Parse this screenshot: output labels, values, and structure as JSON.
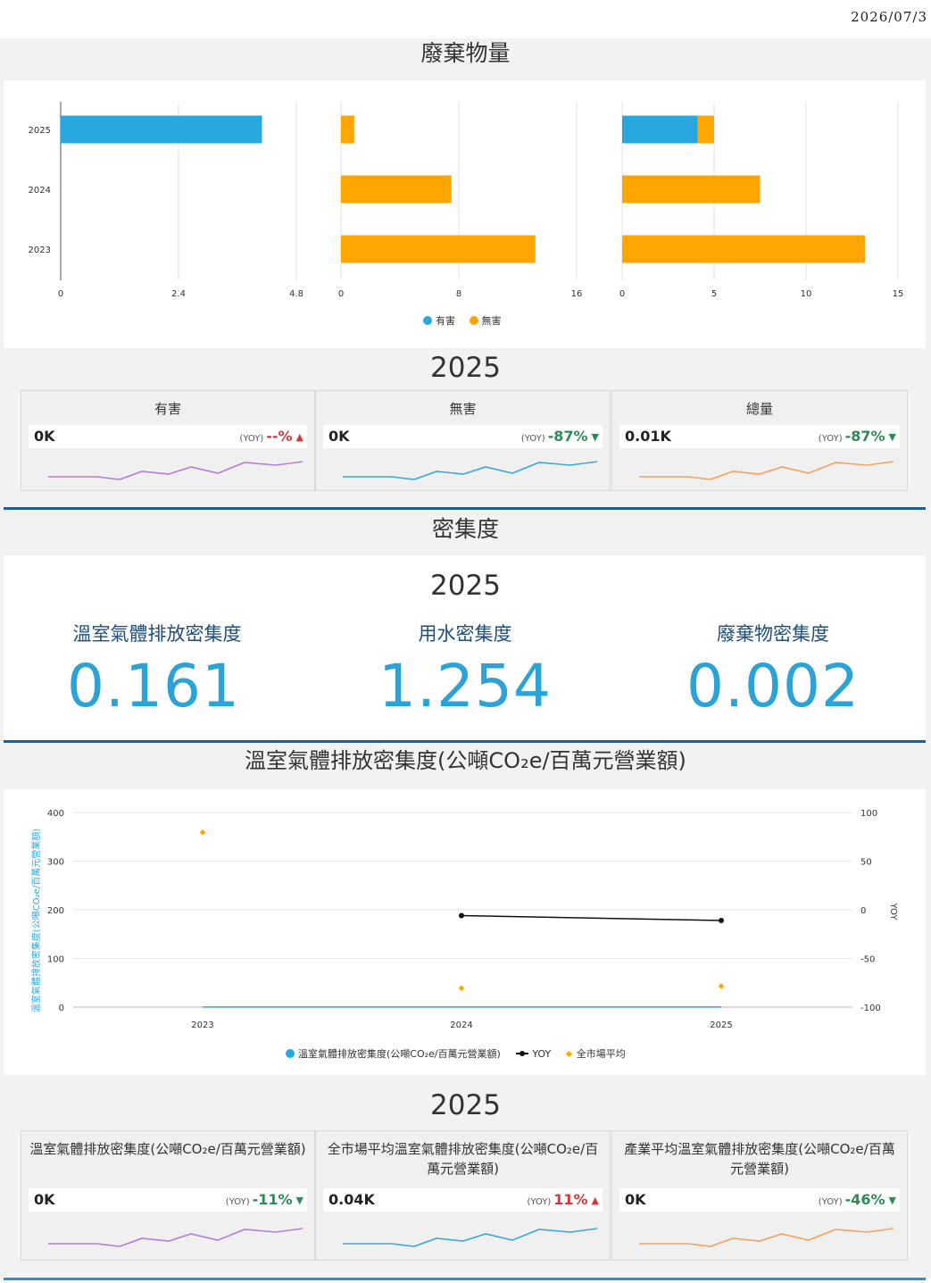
{
  "header": {
    "date": "2026/07/3"
  },
  "waste_section": {
    "title": "廢棄物量",
    "legend": [
      {
        "label": "有害",
        "color": "#29a8e0"
      },
      {
        "label": "無害",
        "color": "#ffa500"
      }
    ],
    "kpi_year": "2025",
    "kpis": [
      {
        "title": "有害",
        "value": "0K",
        "yoy_label": "(YOY)",
        "yoy_value": "--%",
        "direction": "up",
        "spark_color": "#b67ddb"
      },
      {
        "title": "無害",
        "value": "0K",
        "yoy_label": "(YOY)",
        "yoy_value": "-87%",
        "direction": "down",
        "spark_color": "#3aa9d8"
      },
      {
        "title": "總量",
        "value": "0.01K",
        "yoy_label": "(YOY)",
        "yoy_value": "-87%",
        "direction": "down",
        "spark_color": "#f5a35a"
      }
    ]
  },
  "intensity_section": {
    "title": "密集度",
    "year": "2025",
    "items": [
      {
        "label": "溫室氣體排放密集度",
        "value": "0.161"
      },
      {
        "label": "用水密集度",
        "value": "1.254"
      },
      {
        "label": "廢棄物密集度",
        "value": "0.002"
      }
    ]
  },
  "ghg_section": {
    "title": "溫室氣體排放密集度(公噸CO₂e/百萬元營業額)",
    "legend": [
      {
        "label": "溫室氣體排放密集度(公噸CO₂e/百萬元營業額)",
        "color": "#29a8e0"
      },
      {
        "label": "YOY",
        "color": "#111111"
      },
      {
        "label": "全市場平均",
        "color": "#ffa500"
      }
    ],
    "kpi_year": "2025",
    "kpis": [
      {
        "title": "溫室氣體排放密集度(公噸CO₂e/百萬元營業額)",
        "value": "0K",
        "yoy_label": "(YOY)",
        "yoy_value": "-11%",
        "direction": "down",
        "spark_color": "#b67ddb"
      },
      {
        "title": "全市場平均溫室氣體排放密集度(公噸CO₂e/百萬元營業額)",
        "value": "0.04K",
        "yoy_label": "(YOY)",
        "yoy_value": "11%",
        "direction": "up",
        "spark_color": "#3aa9d8"
      },
      {
        "title": "產業平均溫室氣體排放密集度(公噸CO₂e/百萬元營業額)",
        "value": "0K",
        "yoy_label": "(YOY)",
        "yoy_value": "-46%",
        "direction": "down",
        "spark_color": "#f5a35a"
      }
    ]
  },
  "chart_data": [
    {
      "type": "bar",
      "orientation": "horizontal",
      "stacked": false,
      "categories": [
        "2025",
        "2024",
        "2023"
      ],
      "series": [
        {
          "name": "有害",
          "values": [
            4.1,
            0,
            0
          ],
          "color": "#29a8e0"
        }
      ],
      "xticks": [
        "0",
        "2.4",
        "4.8"
      ],
      "xlim": [
        0,
        4.8
      ],
      "grid": true
    },
    {
      "type": "bar",
      "orientation": "horizontal",
      "stacked": false,
      "categories": [
        "2025",
        "2024",
        "2023"
      ],
      "series": [
        {
          "name": "無害",
          "values": [
            0.9,
            7.5,
            13.2
          ],
          "color": "#ffa500"
        }
      ],
      "xticks": [
        "0",
        "8",
        "16"
      ],
      "xlim": [
        0,
        16
      ],
      "grid": true
    },
    {
      "type": "bar",
      "orientation": "horizontal",
      "stacked": true,
      "categories": [
        "2025",
        "2024",
        "2023"
      ],
      "series": [
        {
          "name": "有害",
          "values": [
            4.1,
            0,
            0
          ],
          "color": "#29a8e0"
        },
        {
          "name": "無害",
          "values": [
            0.9,
            7.5,
            13.2
          ],
          "color": "#ffa500"
        }
      ],
      "xticks": [
        "0",
        "5",
        "10",
        "15"
      ],
      "xlim": [
        0,
        15
      ],
      "grid": true
    },
    {
      "type": "line",
      "categories": [
        "2023",
        "2024",
        "2025"
      ],
      "ylabel": "溫室氣體排放密集度(公噸CO₂e/百萬元營業額)",
      "y2label": "YOY",
      "yticks": [
        "0",
        "100",
        "200",
        "300",
        "400"
      ],
      "ylim": [
        0,
        400
      ],
      "y2ticks": [
        "-100",
        "-50",
        "0",
        "50",
        "100"
      ],
      "y2lim": [
        -100,
        100
      ],
      "series": [
        {
          "name": "溫室氣體排放密集度(公噸CO₂e/百萬元營業額)",
          "axis": "left",
          "values": [
            0.18,
            0.18,
            0.16
          ],
          "color": "#29a8e0"
        },
        {
          "name": "YOY",
          "axis": "right",
          "values": [
            null,
            -6,
            -11
          ],
          "color": "#111111"
        },
        {
          "name": "全市場平均",
          "axis": "left",
          "values": [
            359,
            39,
            43
          ],
          "color": "#ffa500",
          "style": "points"
        }
      ],
      "grid": true
    }
  ]
}
